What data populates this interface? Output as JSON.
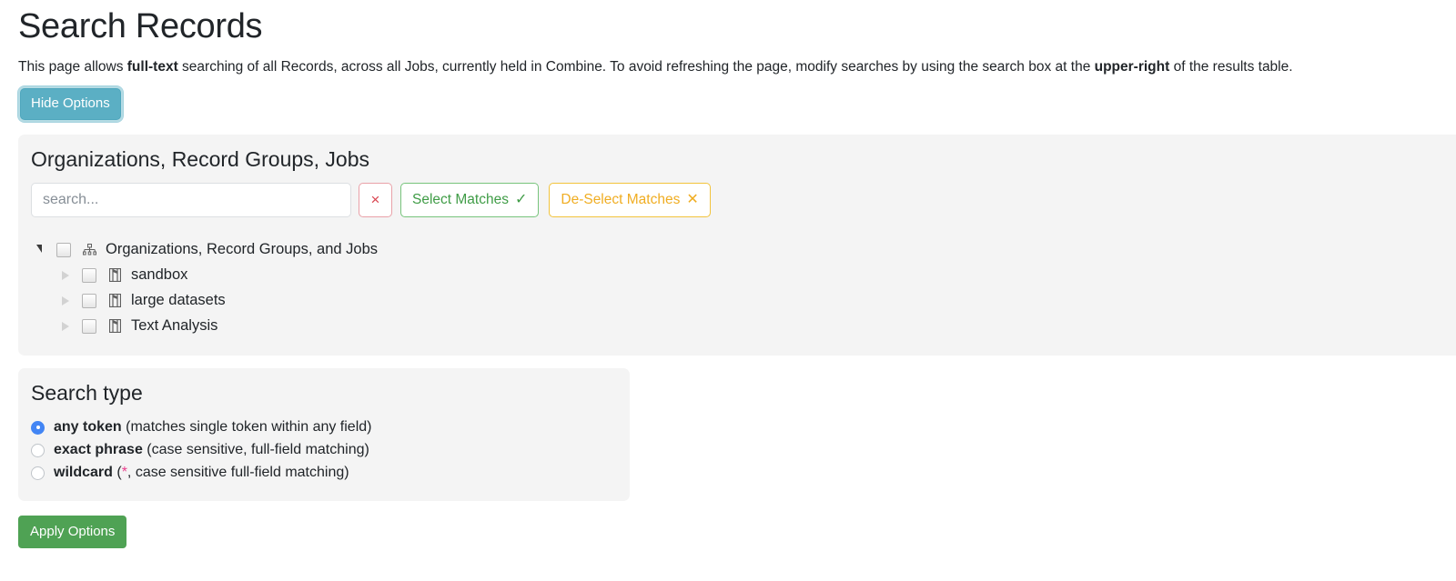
{
  "header": {
    "title": "Search Records",
    "description_pre": "This page allows ",
    "description_bold1": "full-text",
    "description_mid": " searching of all Records, across all Jobs, currently held in Combine. To avoid refreshing the page, modify searches by using the search box at the ",
    "description_bold2": "upper-right",
    "description_post": " of the results table."
  },
  "toolbar": {
    "hide_options_label": "Hide Options"
  },
  "org_panel": {
    "title": "Organizations, Record Groups, Jobs",
    "search": {
      "placeholder": "search...",
      "value": ""
    },
    "clear_button": {
      "glyph": "×",
      "name": "clear-search-button"
    },
    "select_matches": {
      "label": "Select Matches",
      "glyph": "✓"
    },
    "deselect_matches": {
      "label": "De-Select Matches",
      "glyph": "✕"
    },
    "tree": {
      "root": {
        "label": "Organizations, Record Groups, and Jobs",
        "icon": "sitemap-icon",
        "expanded": true,
        "checked": false
      },
      "children": [
        {
          "label": "sandbox",
          "icon": "organization-icon",
          "expanded": false,
          "checked": false
        },
        {
          "label": "large datasets",
          "icon": "organization-icon",
          "expanded": false,
          "checked": false
        },
        {
          "label": "Text Analysis",
          "icon": "organization-icon",
          "expanded": false,
          "checked": false
        }
      ]
    }
  },
  "search_type": {
    "title": "Search type",
    "selected": "any_token",
    "options": [
      {
        "id": "any_token",
        "bold": "any token",
        "rest": " (matches single token within any field)",
        "selected": true
      },
      {
        "id": "exact_phrase",
        "bold": "exact phrase",
        "rest": " (case sensitive, full-field matching)",
        "selected": false
      },
      {
        "id": "wildcard",
        "bold": "wildcard",
        "rest_pre": " (",
        "star": "*",
        "rest_post": ", case sensitive full-field matching)",
        "selected": false
      }
    ]
  },
  "footer": {
    "apply_options_label": "Apply Options"
  },
  "colors": {
    "info": "#5bafc4",
    "success": "#4fa254",
    "danger": "#d9434f",
    "warning": "#f0ad22",
    "radio_accent": "#4285f4",
    "code_pink": "#e83e8c",
    "panel_bg": "#f4f4f4"
  }
}
